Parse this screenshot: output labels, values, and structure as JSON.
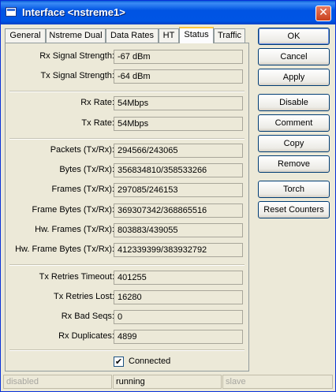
{
  "window": {
    "title": "Interface <nstreme1>",
    "close_glyph": "✕"
  },
  "tabs": [
    {
      "label": "General"
    },
    {
      "label": "Nstreme Dual"
    },
    {
      "label": "Data Rates"
    },
    {
      "label": "HT"
    },
    {
      "label": "Status",
      "active": true
    },
    {
      "label": "Traffic"
    }
  ],
  "status": {
    "rx_signal": {
      "label": "Rx Signal Strength:",
      "value": "-67 dBm"
    },
    "tx_signal": {
      "label": "Tx Signal Strength:",
      "value": "-64 dBm"
    },
    "rx_rate": {
      "label": "Rx Rate:",
      "value": "54Mbps"
    },
    "tx_rate": {
      "label": "Tx Rate:",
      "value": "54Mbps"
    },
    "packets": {
      "label": "Packets (Tx/Rx):",
      "value": "294566/243065"
    },
    "bytes": {
      "label": "Bytes (Tx/Rx):",
      "value": "356834810/358533266"
    },
    "frames": {
      "label": "Frames (Tx/Rx):",
      "value": "297085/246153"
    },
    "frame_bytes": {
      "label": "Frame Bytes (Tx/Rx):",
      "value": "369307342/368865516"
    },
    "hw_frames": {
      "label": "Hw. Frames (Tx/Rx):",
      "value": "803883/439055"
    },
    "hw_frame_bytes": {
      "label": "Hw. Frame Bytes (Tx/Rx):",
      "value": "412339399/383932792"
    },
    "tx_retries_timeout": {
      "label": "Tx Retries Timeout:",
      "value": "401255"
    },
    "tx_retries_lost": {
      "label": "Tx Retries Lost:",
      "value": "16280"
    },
    "rx_bad_seqs": {
      "label": "Rx Bad Seqs:",
      "value": "0"
    },
    "rx_duplicates": {
      "label": "Rx Duplicates:",
      "value": "4899"
    },
    "connected": {
      "label": "Connected",
      "checked": true,
      "glyph": "✔"
    }
  },
  "buttons": {
    "ok": "OK",
    "cancel": "Cancel",
    "apply": "Apply",
    "disable": "Disable",
    "comment": "Comment",
    "copy": "Copy",
    "remove": "Remove",
    "torch": "Torch",
    "reset_counters": "Reset Counters"
  },
  "statusbar": [
    "disabled",
    "running",
    "slave"
  ],
  "icons": {
    "window": "window-icon",
    "close": "close-icon",
    "checkbox": "checkmark-icon"
  }
}
